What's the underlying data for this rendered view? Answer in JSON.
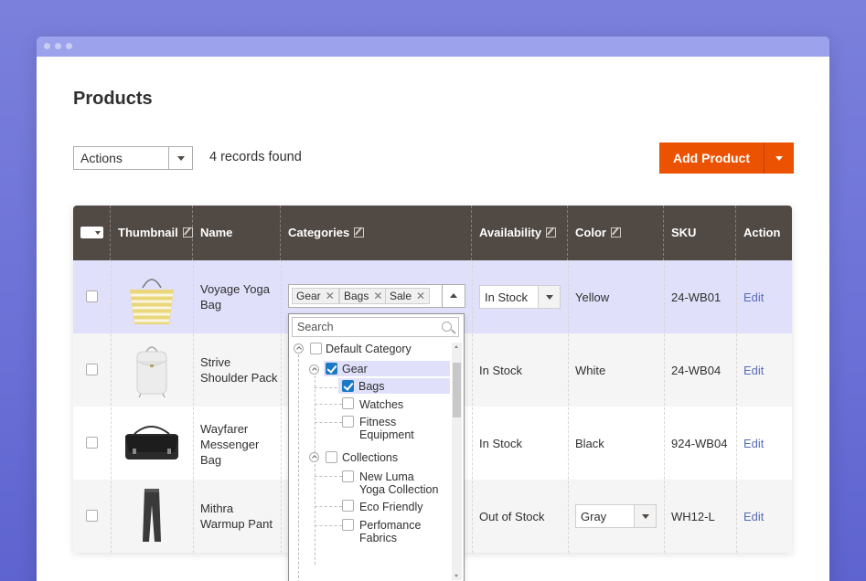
{
  "page": {
    "title": "Products"
  },
  "toolbar": {
    "actions_label": "Actions",
    "records_text": "4 records found",
    "add_label": "Add Product"
  },
  "columns": {
    "thumbnail": "Thumbnail",
    "name": "Name",
    "categories": "Categories",
    "availability": "Availability",
    "color": "Color",
    "sku": "SKU",
    "action": "Action"
  },
  "rows": [
    {
      "name_lines": [
        "Voyage Yoga",
        "Bag"
      ],
      "availability": "In Stock",
      "color": "Yellow",
      "sku": "24-WB01",
      "action": "Edit",
      "thumb": "bag-thumbnail"
    },
    {
      "name_lines": [
        "Strive",
        "Shoulder Pack"
      ],
      "availability": "In Stock",
      "color": "White",
      "sku": "24-WB04",
      "action": "Edit",
      "thumb": "backpack-thumbnail"
    },
    {
      "name_lines": [
        "Wayfarer",
        "Messenger",
        "Bag"
      ],
      "availability": "In Stock",
      "color": "Black",
      "sku": "924-WB04",
      "action": "Edit",
      "thumb": "messenger-thumbnail"
    },
    {
      "name_lines": [
        "Mithra",
        "Warmup Pant"
      ],
      "availability": "Out of Stock",
      "color": "Gray",
      "sku": "WH12-L",
      "action": "Edit",
      "thumb": "pant-thumbnail"
    }
  ],
  "category_tags": [
    "Gear",
    "Bags",
    "Sale"
  ],
  "tree": {
    "search_placeholder": "Search",
    "nodes": [
      {
        "label": "Default Category",
        "checked": false
      },
      {
        "label": "Gear",
        "checked": true
      },
      {
        "label": "Bags",
        "checked": true
      },
      {
        "label": "Watches",
        "checked": false
      },
      {
        "label_lines": [
          "Fitness",
          "Equipment"
        ],
        "checked": false
      },
      {
        "label": "Collections",
        "checked": false
      },
      {
        "label_lines": [
          "New Luma",
          "Yoga Collection"
        ],
        "checked": false
      },
      {
        "label": "Eco Friendly",
        "checked": false
      },
      {
        "label_lines": [
          "Perfomance",
          "Fabrics"
        ],
        "checked": false
      }
    ]
  },
  "colors": {
    "accent": "#eb5202",
    "header": "#514943",
    "selected_row": "#e0e0fb",
    "link": "#5a6cb8",
    "checkbox": "#1979c3"
  }
}
